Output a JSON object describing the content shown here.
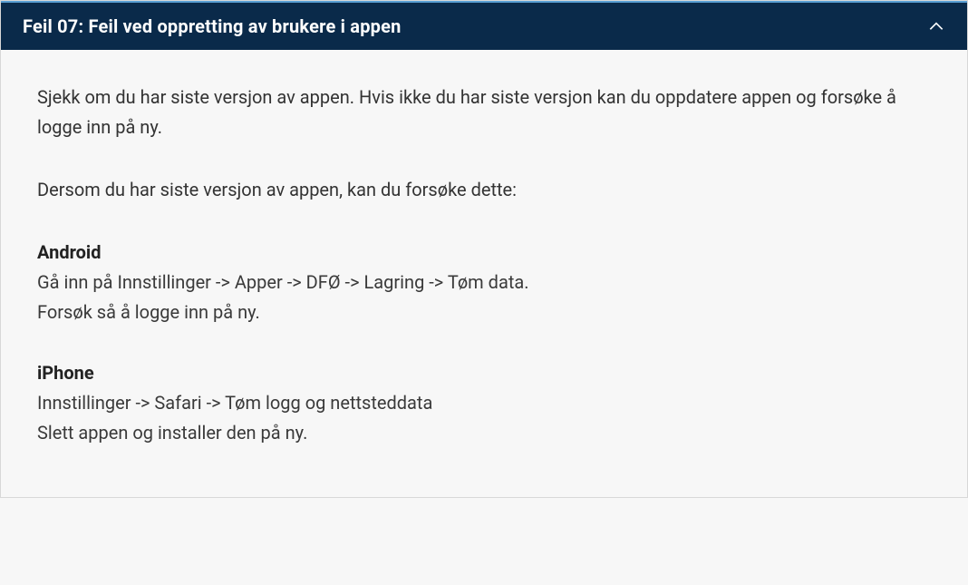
{
  "accordion": {
    "title": "Feil 07: Feil ved oppretting av brukere i appen",
    "body": {
      "intro": "Sjekk om du har siste versjon av appen. Hvis ikke du har siste versjon kan du oppdatere appen og forsøke å logge inn på ny.",
      "instruction": "Dersom du har siste versjon av appen, kan du forsøke dette:",
      "sections": [
        {
          "heading": "Android",
          "line1": "Gå inn på Innstillinger -> Apper -> DFØ -> Lagring -> Tøm data.",
          "line2": "Forsøk så å logge inn på ny."
        },
        {
          "heading": "iPhone",
          "line1": "Innstillinger -> Safari -> Tøm logg og nettsteddata",
          "line2": "Slett appen og installer den på ny."
        }
      ]
    }
  }
}
